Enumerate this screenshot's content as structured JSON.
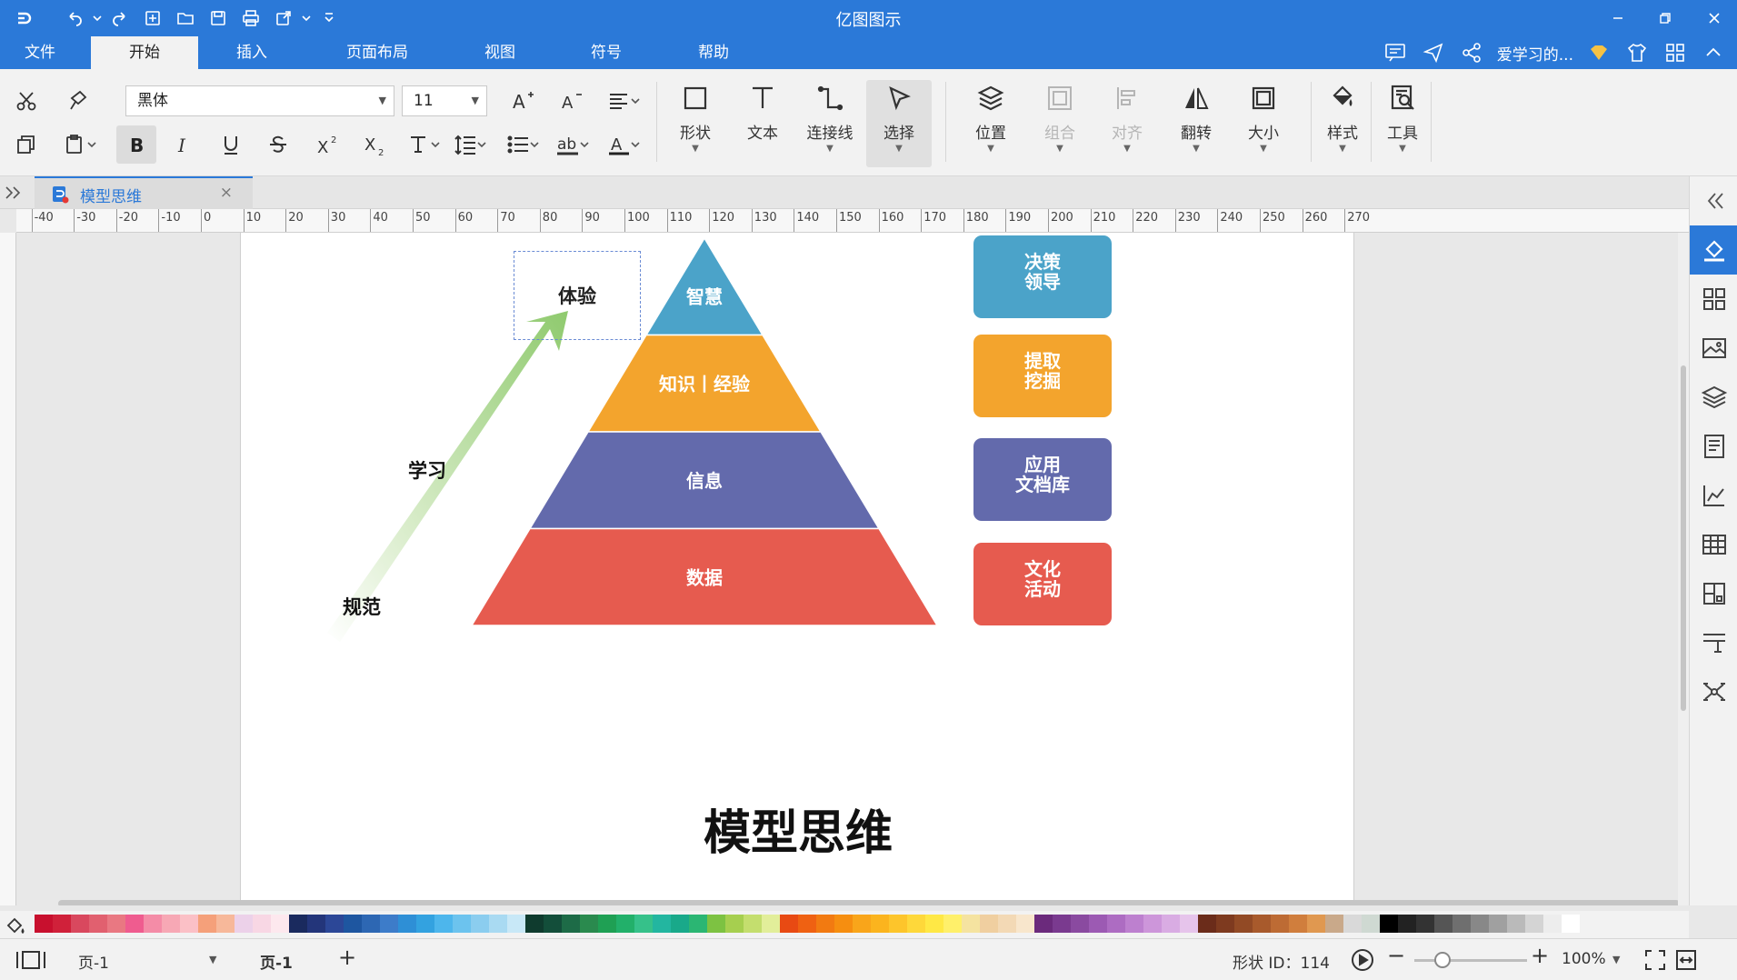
{
  "app": {
    "title": "亿图图示"
  },
  "menu": {
    "items": [
      "文件",
      "开始",
      "插入",
      "页面布局",
      "视图",
      "符号",
      "帮助"
    ],
    "active_index": 1,
    "user_name": "爱学习的..."
  },
  "ribbon": {
    "font_name": "黑体",
    "font_size": "11",
    "groups": {
      "shape": "形状",
      "text": "文本",
      "connector": "连接线",
      "select": "选择",
      "position": "位置",
      "group": "组合",
      "align": "对齐",
      "flip": "翻转",
      "size": "大小",
      "style": "样式",
      "tools": "工具"
    }
  },
  "tab": {
    "document_name": "模型思维"
  },
  "ruler": {
    "marks": [
      "-40",
      "-30",
      "-20",
      "-10",
      "0",
      "10",
      "20",
      "30",
      "40",
      "50",
      "60",
      "70",
      "80",
      "90",
      "100",
      "110",
      "120",
      "130",
      "140",
      "150",
      "160",
      "170",
      "180",
      "190",
      "200",
      "210",
      "220",
      "230",
      "240",
      "250",
      "260",
      "270"
    ]
  },
  "diagram": {
    "title": "模型思维",
    "pyramid_levels": [
      {
        "label": "智慧",
        "color": "#4ba3c9"
      },
      {
        "label": "知识丨经验",
        "color": "#f3a42d"
      },
      {
        "label": "信息",
        "color": "#636aac"
      },
      {
        "label": "数据",
        "color": "#e65b4f"
      }
    ],
    "side_boxes": [
      {
        "line1": "决策",
        "line2": "领导",
        "color": "#4ba3c9"
      },
      {
        "line1": "提取",
        "line2": "挖掘",
        "color": "#f3a42d"
      },
      {
        "line1": "应用",
        "line2": "文档库",
        "color": "#636aac"
      },
      {
        "line1": "文化",
        "line2": "活动",
        "color": "#e65b4f"
      }
    ],
    "arrow_labels": {
      "start": "规范",
      "middle": "学习",
      "end": "体验"
    },
    "arrow_color": "#8fca6e"
  },
  "palette": {
    "colors": [
      "#c8102e",
      "#d0213a",
      "#d9485e",
      "#e1606f",
      "#e97882",
      "#ef5c8f",
      "#f48ca7",
      "#f7a8b5",
      "#fbc0c6",
      "#f5a07a",
      "#f7b89a",
      "#ecd1e9",
      "#f8d7e4",
      "#fde8ee",
      "#1a2a5e",
      "#23357a",
      "#2c4797",
      "#1e56a0",
      "#2d67b3",
      "#3d7cc9",
      "#2e8fd6",
      "#33a2e0",
      "#4db6ec",
      "#6cc3ee",
      "#8bcdef",
      "#a9daf2",
      "#c8e8f7",
      "#0f3b2e",
      "#134e3a",
      "#1d6b47",
      "#2a8a4e",
      "#1fa054",
      "#22b06a",
      "#36c18a",
      "#23b6a0",
      "#19a98a",
      "#2bb673",
      "#7dc242",
      "#a6cf4f",
      "#c4de6e",
      "#e2ee9a",
      "#e84a13",
      "#ef6112",
      "#f27a11",
      "#f68e10",
      "#f9a51a",
      "#fbb41e",
      "#fdc52b",
      "#fed83a",
      "#ffe845",
      "#fff06a",
      "#f5e3a0",
      "#f0cfa0",
      "#f3d9b5",
      "#f8e6cc",
      "#6b2a7c",
      "#7a3a8f",
      "#8a4aa0",
      "#9c5ab3",
      "#ad6cc2",
      "#bd80cf",
      "#cd96da",
      "#d9ace3",
      "#e6c4eb",
      "#6b2c1a",
      "#7e3a1f",
      "#924a25",
      "#a85a2c",
      "#bd6b34",
      "#d07e3d",
      "#e09850",
      "#c9a98a",
      "#d9d9d9",
      "#cfd9d2",
      "#000000",
      "#222222",
      "#333333",
      "#555555",
      "#6f6f6f",
      "#888888",
      "#a0a0a0",
      "#bababa",
      "#d4d4d4",
      "#ededed",
      "#ffffff"
    ]
  },
  "status": {
    "page_selector": "页-1",
    "page_tab": "页-1",
    "shape_id": "形状 ID：114",
    "zoom": "100%"
  }
}
